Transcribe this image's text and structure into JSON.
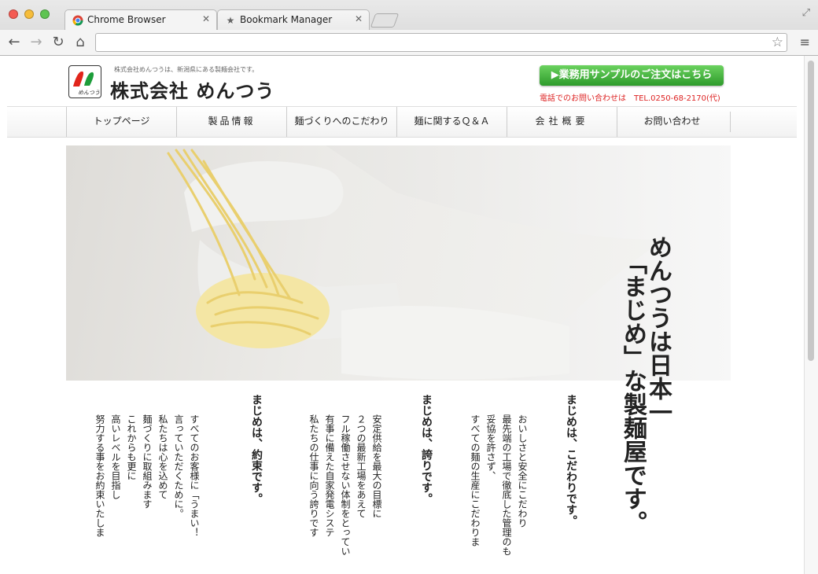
{
  "browser": {
    "tabs": [
      {
        "label": "Chrome Browser",
        "icon": "chrome-icon"
      },
      {
        "label": "Bookmark Manager",
        "icon": "star-icon"
      }
    ],
    "address": ""
  },
  "site": {
    "tagline": "株式会社めんつうは、新潟県にある製麺会社です。",
    "company_name": "株式会社 めんつう",
    "sample_button": "▶業務用サンプルのご注文はこちら",
    "phone": "電話でのお問い合わせは　TEL.0250-68-2170(代)",
    "nav": [
      "トップページ",
      "製品情報",
      "麺づくりへのこだわり",
      "麺に関するＱ＆Ａ",
      "会社概要",
      "お問い合わせ"
    ]
  },
  "content": {
    "title_lines": [
      "めんつうは日本一",
      "「まじめ」な製麺屋です。"
    ],
    "sections": [
      {
        "heading": "まじめは、こだわりです。",
        "lines": [
          "おいしさと安全にこだわり",
          "最先端の工場で徹底した管理のも",
          "妥協を許さず、",
          "すべての麺の生産にこだわりま"
        ]
      },
      {
        "heading": "まじめは、誇りです。",
        "lines": [
          "安定供給を最大の目標に",
          "２つの最新工場をあえて",
          "フル稼働させない体制をとってい",
          "有事に備えた自家発電システ",
          "私たちの仕事に向う誇りです"
        ]
      },
      {
        "heading": "まじめは、約束です。",
        "lines": [
          "すべてのお客様に「うまい！",
          "言っていただくために。",
          "私たちは心を込めて",
          "麺づくりに取組みます",
          "これからも更に",
          "高いレベルを目指し",
          "努力する事をお約束いたしま"
        ]
      }
    ]
  }
}
